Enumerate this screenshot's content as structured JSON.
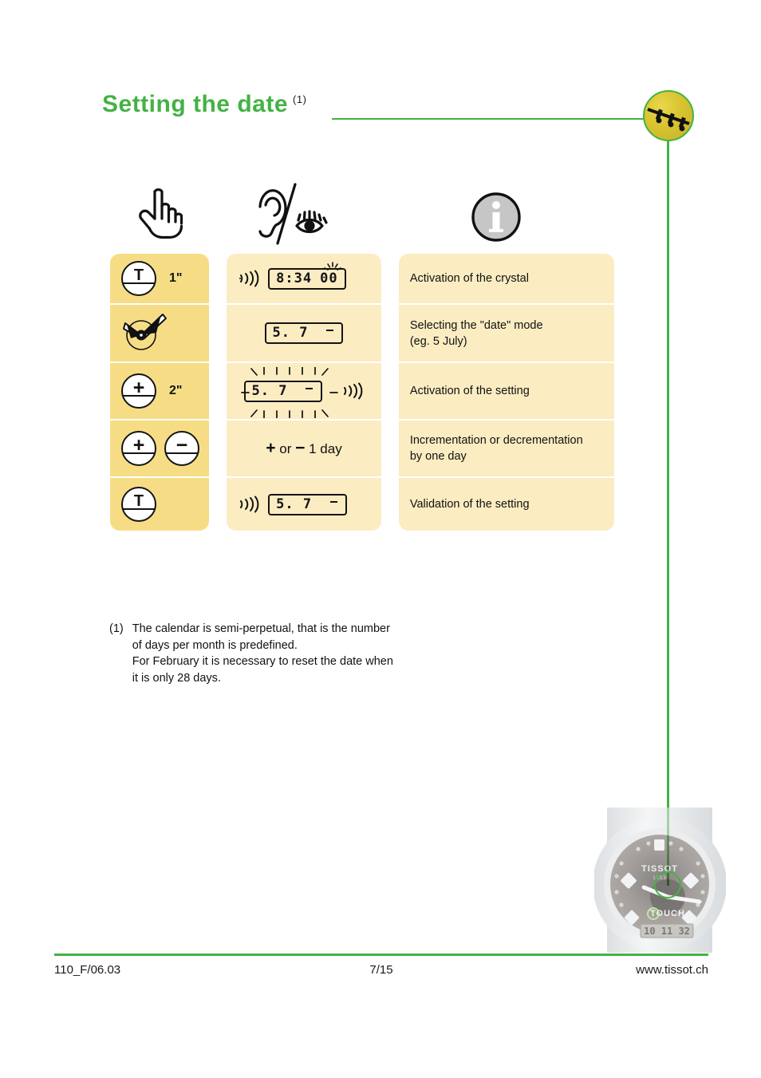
{
  "page": {
    "title": "Setting  the  date",
    "title_superscript": "(1)",
    "accent_green": "#44b244",
    "col1_bg": "#f6dd85",
    "col23_bg": "#fbecc2"
  },
  "header_icons": [
    {
      "name": "hand-pointing-icon",
      "label": "hand"
    },
    {
      "name": "ear-eye-icon",
      "label": "ear / eye"
    },
    {
      "name": "info-icon",
      "label": "i"
    }
  ],
  "badge": {
    "name": "watch-pushers-badge",
    "label": "pushers"
  },
  "table": {
    "rows": [
      {
        "action": {
          "button": "T",
          "duration": "1\""
        },
        "feedback": {
          "sound": true,
          "lcd": "8:34",
          "lcd_extra": "00",
          "flash": false,
          "crystal": true
        },
        "description": "Activation of the crystal"
      },
      {
        "action": {
          "button": "watch-hands",
          "duration": ""
        },
        "feedback": {
          "sound": false,
          "lcd": "5. 7",
          "flash": false
        },
        "description": "Selecting the \"date\" mode\n(eg. 5 July)"
      },
      {
        "action": {
          "button": "+",
          "duration": "2\""
        },
        "feedback": {
          "sound": true,
          "lcd": "5. 7",
          "flash": true
        },
        "description": "Activation of the setting"
      },
      {
        "action": {
          "button": "+ −",
          "duration": ""
        },
        "feedback": {
          "text": "+ or − 1 day"
        },
        "description": "Incrementation or decrementation\nby one day"
      },
      {
        "action": {
          "button": "T",
          "duration": ""
        },
        "feedback": {
          "sound": true,
          "lcd": "5. 7",
          "flash": false
        },
        "description": "Validation of the setting"
      }
    ],
    "descriptions": [
      "Activation of the crystal",
      "Selecting the \"date\" mode",
      "(eg. 5 July)",
      "Activation of the setting",
      "Incrementation or decrementation",
      "by one day",
      "Validation of the setting"
    ],
    "lcd_values": {
      "row1": "8:34",
      "row1_extra": "00",
      "row2": "5. 7",
      "row3": "5. 7",
      "row5": "5. 7"
    },
    "buttons": {
      "t": "T",
      "plus": "+",
      "minus": "−"
    },
    "durations": {
      "row1": "1\"",
      "row3": "2\""
    },
    "row4_feedback": {
      "plus": "+",
      "or": "or",
      "minus": "−",
      "day": "1 day"
    }
  },
  "footnote": {
    "marker": "(1)",
    "line1": "The calendar is semi-perpetual, that is the number",
    "line2": "of days per month is predefined.",
    "line3": "For February it is necessary to reset the date when",
    "line4": "it is only 28 days."
  },
  "watch": {
    "brand": "TISSOT",
    "sub": "1853",
    "model": "TOUCH",
    "lcd": "10 11  32"
  },
  "footer": {
    "left": "110_F/06.03",
    "center": "7/15",
    "right": "www.tissot.ch"
  }
}
